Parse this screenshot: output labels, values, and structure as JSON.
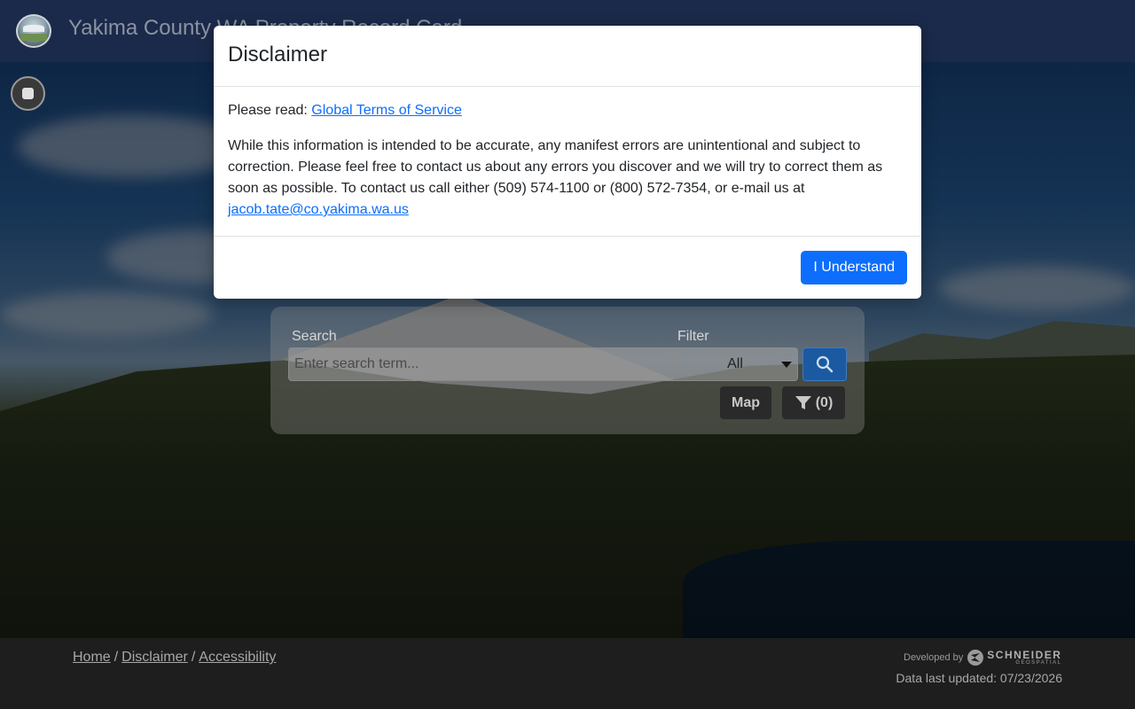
{
  "header": {
    "title": "Yakima County WA Property Record Card"
  },
  "search": {
    "label": "Search",
    "placeholder": "Enter search term...",
    "value": "",
    "filter_label": "Filter",
    "filter_selected": "All",
    "map_label": "Map",
    "filter_count": "(0)"
  },
  "footer": {
    "links": [
      {
        "label": "Home"
      },
      {
        "label": "Disclaimer"
      },
      {
        "label": "Accessibility"
      }
    ],
    "separator": "/",
    "developed_by": "Developed by",
    "brand": "SCHNEIDER",
    "brand_sub": "GEOSPATIAL",
    "updated": "Data last updated: 07/23/2026"
  },
  "modal": {
    "title": "Disclaimer",
    "please_read": "Please read:",
    "tos_link": "Global Terms of Service",
    "body_text": "While this information is intended to be accurate, any manifest errors are unintentional and subject to correction. Please feel free to contact us about any errors you discover and we will try to correct them as soon as possible. To contact us call either (509) 574-1100 or (800) 572-7354, or e-mail us at",
    "email": "jacob.tate@co.yakima.wa.us",
    "button": "I Understand"
  },
  "colors": {
    "header_bg": "#1b2a4a",
    "primary": "#0d6efd",
    "footer_bg": "#1e1e1e"
  },
  "icons": {
    "logo": "county-seal-logo",
    "stop": "stop-icon",
    "search": "search-icon",
    "filter": "funnel-icon",
    "brand": "schneider-logo-icon"
  }
}
